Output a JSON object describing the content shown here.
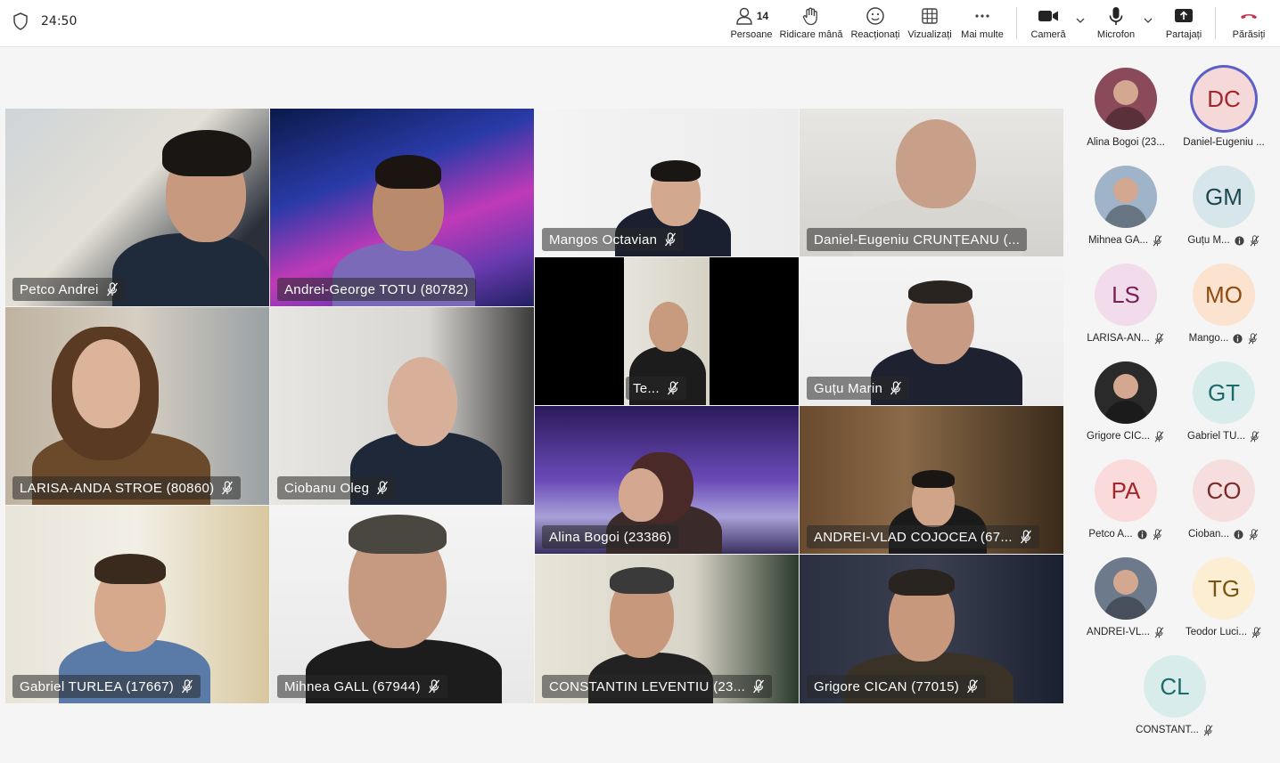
{
  "topbar": {
    "timer": "24:50",
    "buttons": {
      "people": {
        "label": "Persoane",
        "count": "14"
      },
      "raise_hand": {
        "label": "Ridicare mână"
      },
      "react": {
        "label": "Reacționați"
      },
      "view": {
        "label": "Vizualizați"
      },
      "more": {
        "label": "Mai multe"
      },
      "camera": {
        "label": "Cameră"
      },
      "mic": {
        "label": "Microfon"
      },
      "share": {
        "label": "Partajați"
      },
      "leave": {
        "label": "Părăsiți"
      }
    }
  },
  "video_tiles": [
    {
      "name": "Petco Andrei"
    },
    {
      "name": "Andrei-George TOTU (80782)"
    },
    {
      "name": "LARISA-ANDA STROE (80860)"
    },
    {
      "name": "Ciobanu Oleg"
    },
    {
      "name": "Gabriel TURLEA (17667)"
    },
    {
      "name": "Mihnea GALL (67944)"
    },
    {
      "name": "Mangos Octavian"
    },
    {
      "name": "Daniel-Eugeniu CRUNȚEANU (..."
    },
    {
      "name": "Te..."
    },
    {
      "name": "Guțu Marin"
    },
    {
      "name": "Alina Bogoi (23386)"
    },
    {
      "name": "ANDREI-VLAD COJOCEA (67..."
    },
    {
      "name": "CONSTANTIN LEVENTIU (23..."
    },
    {
      "name": "Grigore CICAN (77015)"
    }
  ],
  "participants": [
    {
      "initials": "",
      "name": "Alina Bogoi (23...",
      "bg": "#8a4a5a",
      "color": "#ffffff"
    },
    {
      "initials": "DC",
      "name": "Daniel-Eugeniu ...",
      "bg": "#f5d8d8",
      "color": "#a4262c"
    },
    {
      "initials": "",
      "name": "Mihnea GA...",
      "bg": "#9fb4c8",
      "color": "#ffffff"
    },
    {
      "initials": "GM",
      "name": "Guțu M...",
      "bg": "#d6e6ea",
      "color": "#1f4650"
    },
    {
      "initials": "LS",
      "name": "LARISA-AN...",
      "bg": "#f2dbea",
      "color": "#7a2058"
    },
    {
      "initials": "MO",
      "name": "Mango...",
      "bg": "#fbe3cf",
      "color": "#8e4a13"
    },
    {
      "initials": "",
      "name": "Grigore CIC...",
      "bg": "#2a2a2a",
      "color": "#ffffff"
    },
    {
      "initials": "GT",
      "name": "Gabriel TU...",
      "bg": "#d8ecec",
      "color": "#1d6a6a"
    },
    {
      "initials": "PA",
      "name": "Petco A...",
      "bg": "#fadada",
      "color": "#a4262c"
    },
    {
      "initials": "CO",
      "name": "Cioban...",
      "bg": "#f6dede",
      "color": "#7a2a2a"
    },
    {
      "initials": "",
      "name": "ANDREI-VL...",
      "bg": "#6c7a8c",
      "color": "#ffffff"
    },
    {
      "initials": "TG",
      "name": "Teodor Luci...",
      "bg": "#fbeed2",
      "color": "#7a5413"
    },
    {
      "initials": "CL",
      "name": "CONSTANT...",
      "bg": "#d8ecec",
      "color": "#1d6a6a"
    }
  ]
}
